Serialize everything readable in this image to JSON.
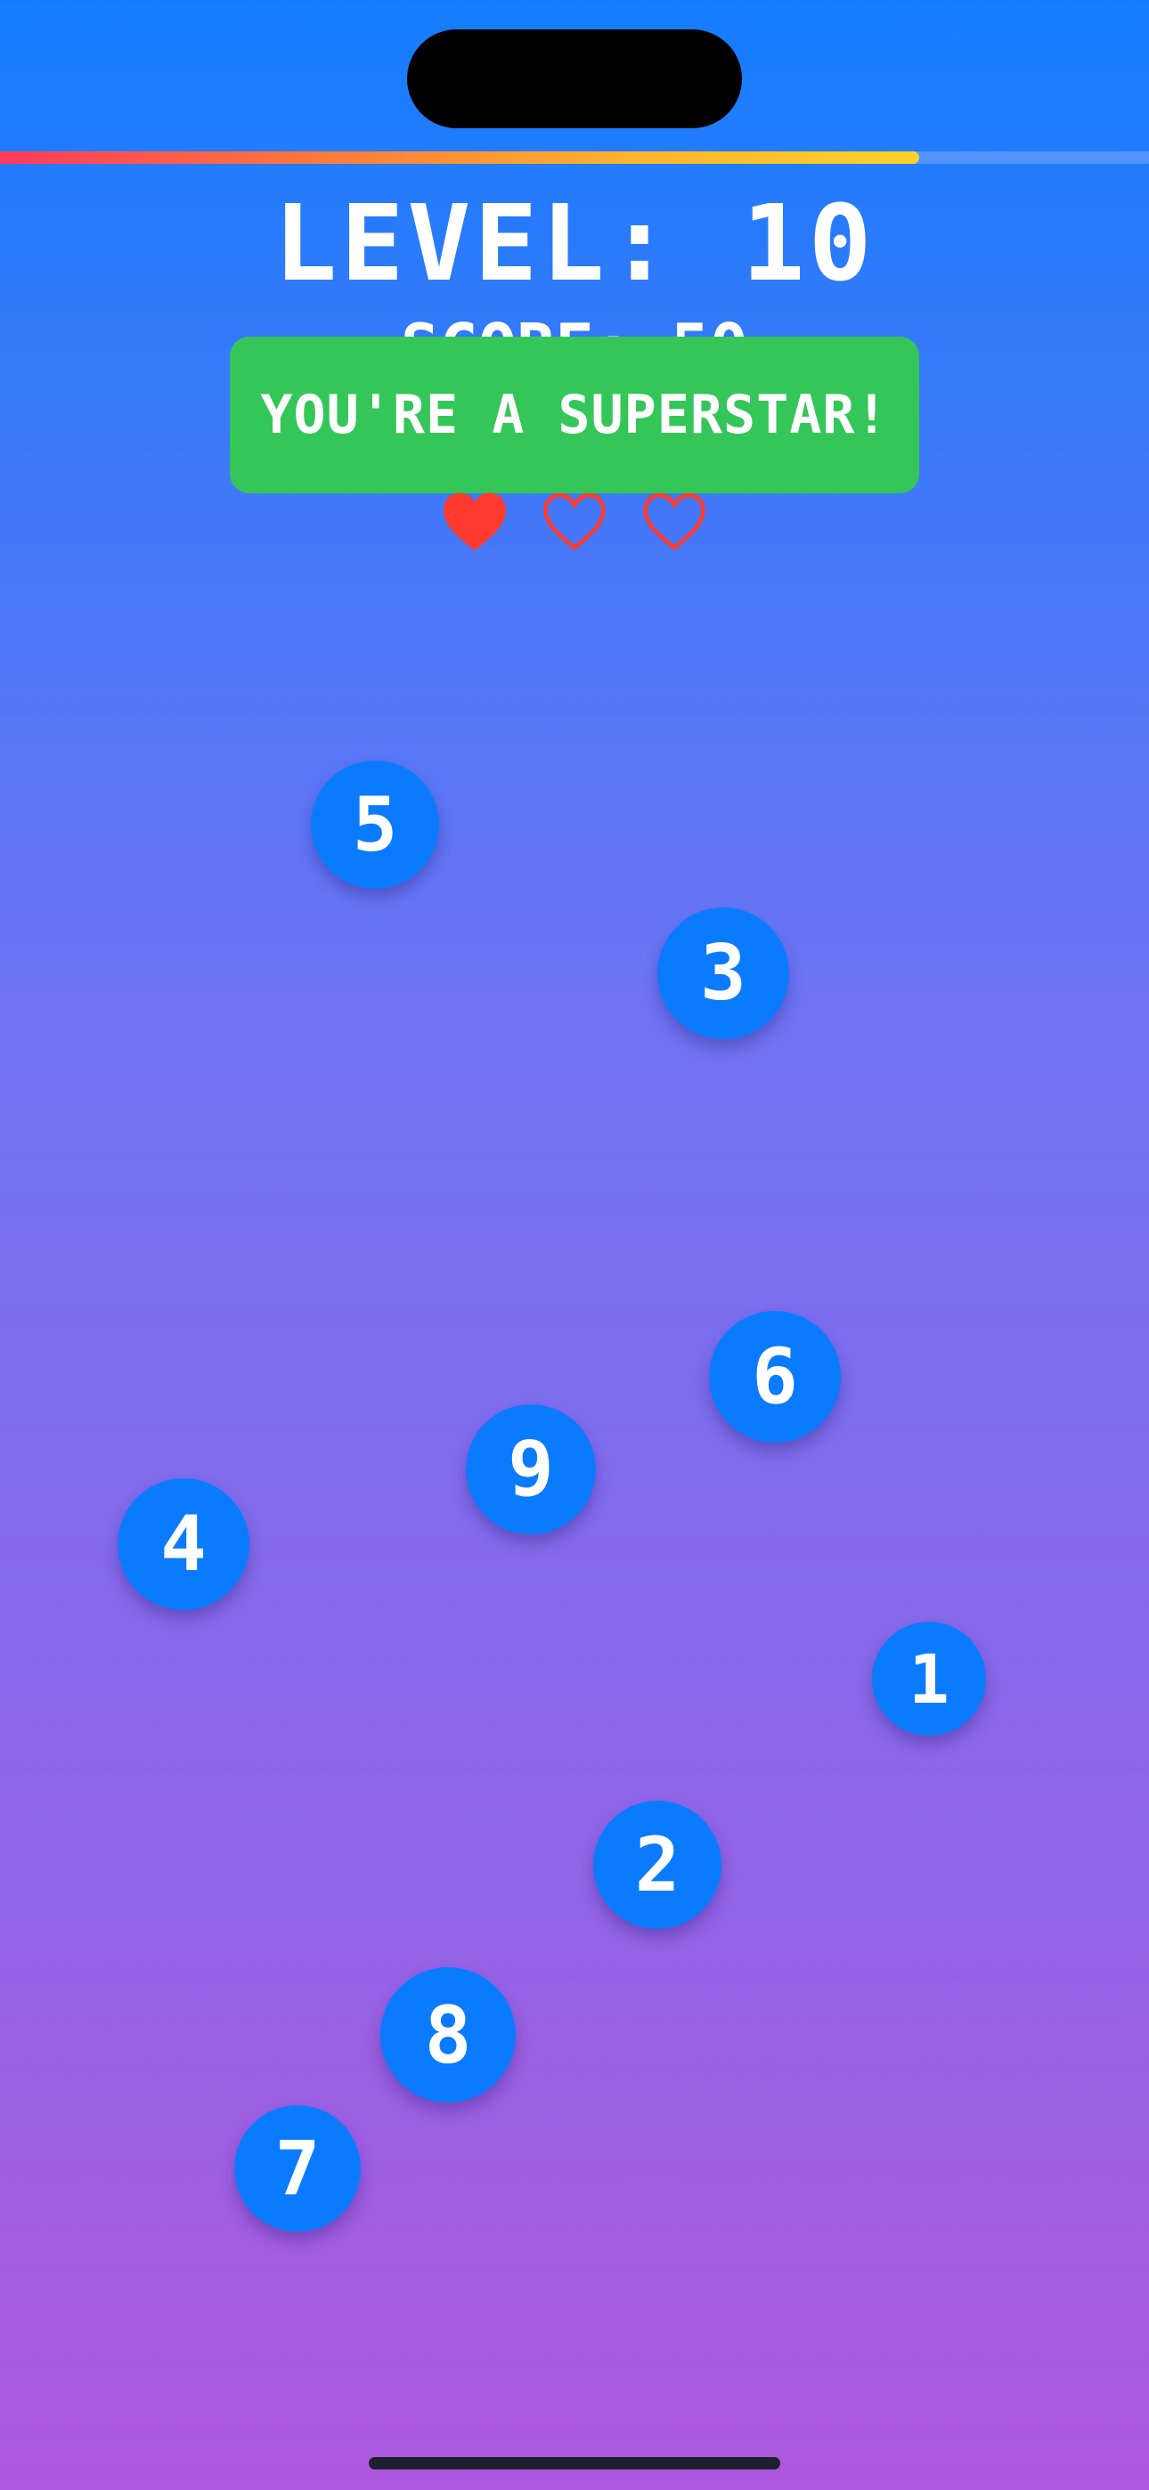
{
  "hud": {
    "level_text": "LEVEL: 10",
    "score_text": "SCORE: 50",
    "progress": 0.8,
    "progress_gradient": [
      "#ff3b5c",
      "#ff7a3b",
      "#ffb52e",
      "#ffd22a"
    ]
  },
  "toast": {
    "text": "YOU'RE A SUPERSTAR!",
    "color": "#34c659"
  },
  "lives": {
    "total": 3,
    "remaining": 1,
    "icon": "heart-icon",
    "color": "#ff3b30"
  },
  "bubbles": [
    {
      "number": "5"
    },
    {
      "number": "3"
    },
    {
      "number": "6"
    },
    {
      "number": "9"
    },
    {
      "number": "4"
    },
    {
      "number": "1"
    },
    {
      "number": "2"
    },
    {
      "number": "8"
    },
    {
      "number": "7"
    }
  ],
  "colors": {
    "bubble": "#0a7bfe",
    "background_top": "#147dfe",
    "background_bottom": "#ad58de"
  }
}
